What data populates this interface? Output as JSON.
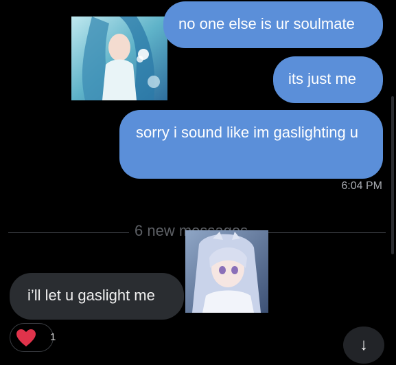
{
  "colors": {
    "sent_bubble": "#5b8fd9",
    "received_bubble": "#2a2d31",
    "background": "#000000",
    "reaction_heart": "#e0334b"
  },
  "messages": [
    {
      "text": "no one else is ur soulmate",
      "direction": "sent"
    },
    {
      "text": "its just me",
      "direction": "sent"
    },
    {
      "text": "sorry i sound like im gaslighting u",
      "direction": "sent"
    },
    {
      "text": "i’ll let u gaslight me",
      "direction": "received"
    }
  ],
  "timestamp": "6:04 PM",
  "new_messages_label": "6 new messages",
  "reaction": {
    "icon": "heart-icon",
    "count": "1"
  },
  "scroll_button": {
    "icon": "arrow-down-icon",
    "glyph": "↓"
  }
}
